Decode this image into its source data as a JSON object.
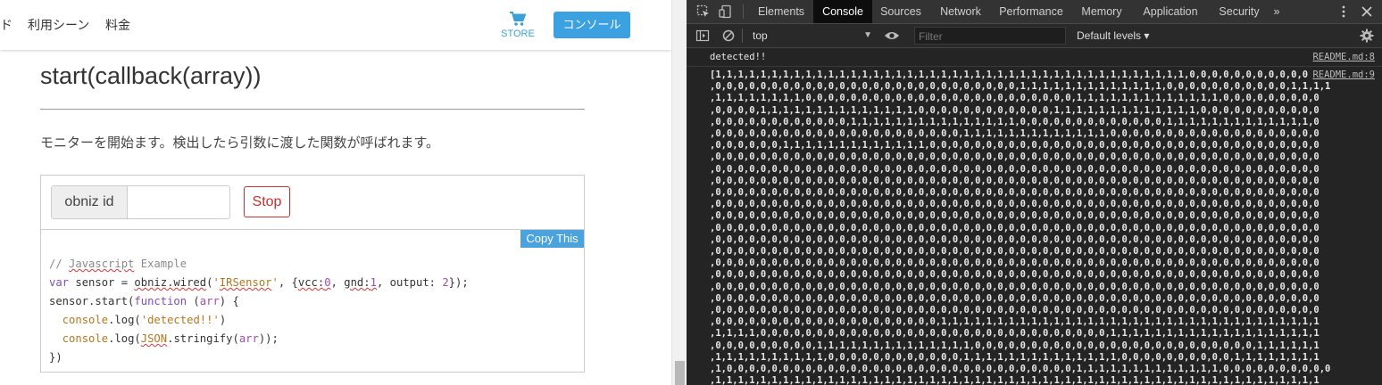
{
  "left": {
    "nav": {
      "items": [
        "ド",
        "利用シーン",
        "料金"
      ],
      "store_label": "STORE",
      "console_label": "コンソール"
    },
    "heading": "start(callback(array))",
    "description": "モニターを開始ます。検出したら引数に渡した関数が呼ばれます。",
    "example": {
      "input_addon": "obniz id",
      "input_value": "",
      "stop_label": "Stop",
      "copy_label": "Copy This",
      "code_lines": [
        "// Javascript Example",
        "var sensor = obniz.wired('IRSensor', {vcc:0, gnd:1, output: 2});",
        "sensor.start(function (arr) {",
        "  console.log('detected!!')",
        "  console.log(JSON.stringify(arr));",
        "})"
      ]
    }
  },
  "devtools": {
    "tabs": [
      "Elements",
      "Console",
      "Sources",
      "Network",
      "Performance",
      "Memory",
      "Application",
      "Security",
      "»"
    ],
    "active_tab": "Console",
    "context": "top",
    "filter_placeholder": "Filter",
    "levels": "Default levels ▾",
    "messages": [
      {
        "text": "detected!!",
        "source": "README.md:8"
      },
      {
        "source": "README.md:9",
        "lines": [
          "[1,1,1,1,1,1,1,1,1,1,1,1,1,1,1,1,1,1,1,1,1,1,1,1,1,1,1,1,1,1,1,1,1,1,1,1,1,1,1,1,1,1,0,0,0,0,0,0,0,0,0,0,0",
          ",0,0,0,0,0,0,0,0,0,0,0,0,0,0,0,0,0,0,0,0,0,0,0,0,0,0,0,1,1,1,1,1,1,1,1,1,1,1,1,1,0,0,0,0,0,0,0,0,0,0,0,1,1,1,1",
          ",1,1,1,1,1,1,1,1,0,0,0,0,0,0,0,0,0,0,0,0,0,0,0,0,0,0,0,0,0,0,0,0,1,1,1,1,1,1,1,1,1,1,1,1,1,0,0,0,0,0,0,0,0,0",
          ",0,0,0,0,1,1,1,1,1,1,1,1,1,1,1,1,1,1,0,0,0,0,0,0,0,0,0,0,0,0,1,1,1,1,1,1,1,1,1,1,1,1,1,0,0,0,0,0,0,0,0,0,0,0",
          ",0,0,0,0,0,0,0,0,0,0,0,0,1,1,1,1,1,1,1,1,1,1,1,1,1,1,1,0,0,0,0,0,0,0,0,0,0,0,0,0,1,1,1,1,1,1,1,1,1,1,1,1,1,0",
          ",0,0,0,0,0,0,0,0,0,0,0,0,0,0,0,0,0,0,0,0,0,0,1,1,1,1,1,1,1,1,1,1,1,1,1,0,0,0,0,0,0,0,0,0,0,0,0,0,0,0,0,0,0,0",
          ",0,0,0,0,0,0,1,1,1,1,1,1,1,1,1,1,1,1,1,0,0,0,0,0,0,0,0,0,0,0,0,0,0,0,0,0,0,0,0,0,0,0,0,0,0,0,0,0,0,0,0,0,0,0",
          ",0,0,0,0,0,0,0,0,0,0,0,0,0,0,0,0,0,0,0,0,0,0,0,0,0,0,0,0,0,0,0,0,0,0,0,0,0,0,0,0,0,0,0,0,0,0,0,0,0,0,0,0,0,0",
          ",0,0,0,0,0,0,0,0,0,0,0,0,0,0,0,0,0,0,0,0,0,0,0,0,0,0,0,0,0,0,0,0,0,0,0,0,0,0,0,0,0,0,0,0,0,0,0,0,0,0,0,0,0,0",
          ",0,0,0,0,0,0,0,0,0,0,0,0,0,0,0,0,0,0,0,0,0,0,0,0,0,0,0,0,0,0,0,0,0,0,0,0,0,0,0,0,0,0,0,0,0,0,0,0,0,0,0,0,0,0",
          ",0,0,0,0,0,0,0,0,0,0,0,0,0,0,0,0,0,0,0,0,0,0,0,0,0,0,0,0,0,0,0,0,0,0,0,0,0,0,0,0,0,0,0,0,0,0,0,0,0,0,0,0,0,0",
          ",0,0,0,0,0,0,0,0,0,0,0,0,0,0,0,0,0,0,0,0,0,0,0,0,0,0,0,0,0,0,0,0,0,0,0,0,0,0,0,0,0,0,0,0,0,0,0,0,0,0,0,0,0,0",
          ",0,0,0,0,0,0,0,0,0,0,0,0,0,0,0,0,0,0,0,0,0,0,0,0,0,0,0,0,0,0,0,0,0,0,0,0,0,0,0,0,0,0,0,0,0,0,0,0,0,0,0,0,0,0",
          ",0,0,0,0,0,0,0,0,0,0,0,0,0,0,0,0,0,0,0,0,0,0,0,0,0,0,0,0,0,0,0,0,0,0,0,0,0,0,0,0,0,0,0,0,0,0,0,0,0,0,0,0,0,0",
          ",0,0,0,0,0,0,0,0,0,0,0,0,0,0,0,0,0,0,0,0,0,0,0,0,0,0,0,0,0,0,0,0,0,0,0,0,0,0,0,0,0,0,0,0,0,0,0,0,0,0,0,0,0,0",
          ",0,0,0,0,0,0,0,0,0,0,0,0,0,0,0,0,0,0,0,0,0,0,0,0,0,0,0,0,0,0,0,0,0,0,0,0,0,0,0,0,0,0,0,0,0,0,0,0,0,0,0,0,0,0",
          ",0,0,0,0,0,0,0,0,0,0,0,0,0,0,0,0,0,0,0,0,0,0,0,0,0,0,0,0,0,0,0,0,0,0,0,0,0,0,0,0,0,0,0,0,0,0,0,0,0,0,0,0,0,0",
          ",0,0,0,0,0,0,0,0,0,0,0,0,0,0,0,0,0,0,0,0,0,0,0,0,0,0,0,0,0,0,0,0,0,0,0,0,0,0,0,0,0,0,0,0,0,0,0,0,0,0,0,0,0,0",
          ",0,0,0,0,0,0,0,0,0,0,0,0,0,0,0,0,0,0,0,0,0,0,0,0,0,0,0,0,0,0,0,0,0,0,0,0,0,0,0,0,0,0,0,0,0,0,0,0,0,0,0,0,0,0",
          ",0,0,0,0,0,0,0,0,0,0,0,0,0,0,0,0,0,0,0,0,0,0,0,0,0,0,0,0,0,0,0,0,0,0,0,0,0,0,0,0,0,0,0,0,0,0,0,0,0,0,0,0,0,0",
          ",0,0,0,0,0,0,0,0,0,0,0,0,0,0,0,0,0,0,0,0,0,0,0,0,0,0,0,0,0,0,0,0,0,0,0,0,0,0,0,0,0,0,0,0,0,0,0,0,0,0,0,0,0,0",
          ",0,0,0,0,0,0,0,0,0,0,0,0,0,0,0,0,0,0,0,0,1,1,1,1,1,1,1,1,1,1,1,1,1,1,1,1,1,1,1,1,1,1,1,1,1,1,1,1,1,1,1,1,1,1",
          ",1,1,1,1,0,0,0,0,0,0,0,0,0,0,0,0,0,0,0,0,0,0,0,0,0,0,0,0,0,0,0,0,0,0,0,1,1,1,1,1,1,1,1,1,1,1,1,1,1,1,1,1,1,1",
          ",0,0,0,0,0,0,0,0,0,1,1,1,1,1,1,1,1,1,1,1,1,1,1,0,0,0,0,0,0,0,0,0,0,0,0,0,0,0,0,0,0,0,0,0,0,0,0,0,1,1,1,1,1,1",
          ",1,1,1,1,1,1,1,1,1,1,0,0,0,0,0,0,0,0,0,0,0,0,1,1,1,1,1,1,1,1,1,1,1,1,1,1,0,0,0,0,0,0,0,0,0,0,1,1,1,1,1,1,1,1",
          ",1,0,0,0,0,0,0,0,0,0,0,0,0,0,0,0,0,0,0,0,0,0,0,0,0,0,0,0,0,0,0,0,1,1,1,1,1,1,1,1,1,1,1,1,1,0,0,0,0,0,0,0,0,0,0",
          ",1,1,1,1,1,1,1,1,1,1,1,1,1,1,1,1,1,1,1,1,1,1,1,1,1,1,1,1,1,1,1,1,1,1,1,1,1,1,1,1,1,1,1,1,1,1,1,1,1,1,1,1,1,1"
        ]
      }
    ]
  }
}
